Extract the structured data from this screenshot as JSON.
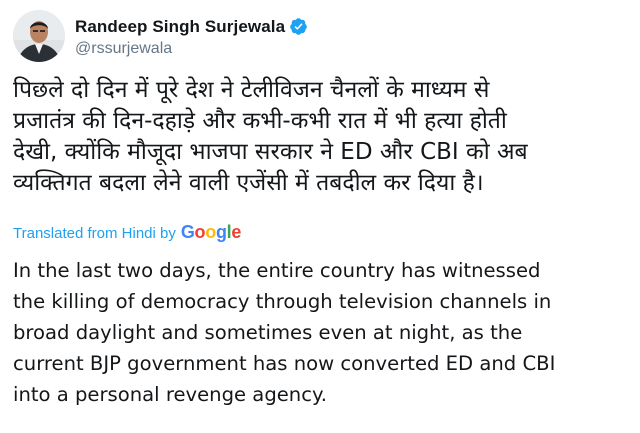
{
  "author": {
    "display_name": "Randeep Singh Surjewala",
    "handle": "@rssurjewala",
    "verified_icon": "verified-badge-icon"
  },
  "tweet": {
    "hindi_lines": [
      "पिछले दो दिन में पूरे देश ने टेलीविजन चैनलों के माध्यम से",
      "प्रजातंत्र की दिन-दहाड़े और कभी-कभी रात में भी हत्या होती",
      "देखी, क्योंकि मौजूदा भाजपा सरकार ने ED और CBI को अब",
      "व्यक्तिगत बदला लेने वाली एजेंसी में तबदील कर दिया है।"
    ],
    "translated_label": "Translated from Hindi by",
    "translation_provider": "Google",
    "english_lines": [
      "In the last two days, the entire country has witnessed",
      "the killing of democracy through television channels in",
      "broad daylight and sometimes even at night, as the",
      "current BJP government has now converted ED and CBI",
      "into a personal revenge agency."
    ]
  },
  "colors": {
    "text": "#14171a",
    "secondary_text": "#657786",
    "link_blue": "#1da1f2",
    "google_blue": "#4285F4",
    "google_red": "#EA4335",
    "google_yellow": "#FBBC05",
    "google_green": "#34A853"
  }
}
